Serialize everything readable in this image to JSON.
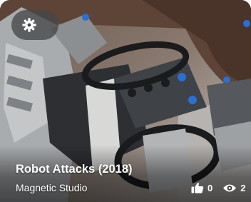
{
  "card": {
    "title": "Robot Attacks (2018)",
    "author": "Magnetic Studio",
    "likes": "0",
    "views": "2"
  },
  "icons": {
    "settings": "gear-icon",
    "likes": "thumbs-up-icon",
    "views": "eye-icon"
  },
  "colors": {
    "text": "#ffffff",
    "overlay_button": "#464648"
  }
}
